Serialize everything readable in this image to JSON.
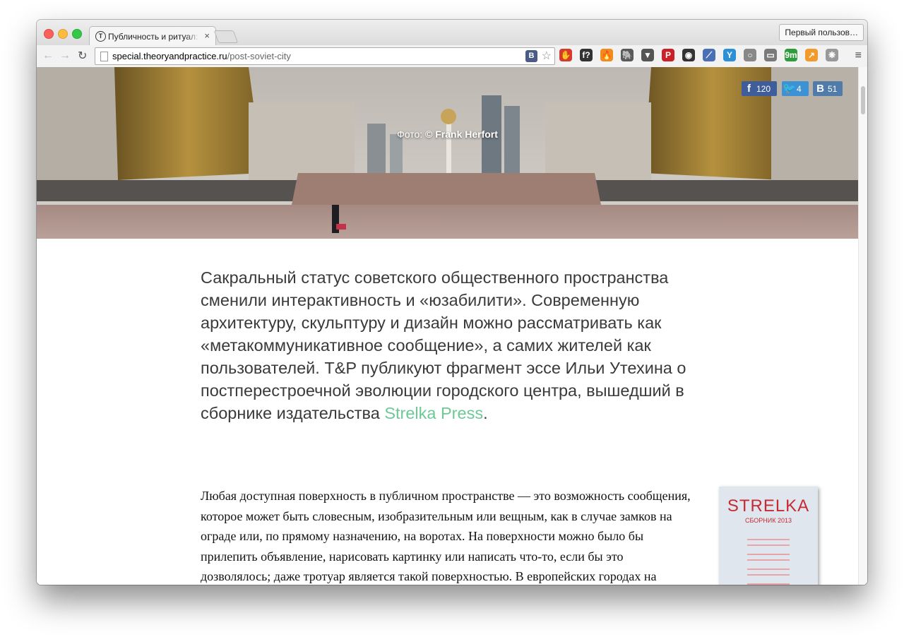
{
  "browser": {
    "tab_title": "Публичность и ритуал: Ил",
    "tab_close": "×",
    "profile_label": "Первый пользов…",
    "url_host": "special.theoryandpractice.ru",
    "url_path": "/post-soviet-city",
    "back_icon": "←",
    "forward_icon": "→",
    "reload_icon": "↻",
    "menu_icon": "≡",
    "vk_ext_label": "B",
    "star_icon": "☆",
    "extensions": [
      {
        "icon": "adblock-icon",
        "glyph": "✋",
        "color": "#d53a2d"
      },
      {
        "icon": "fontface-icon",
        "glyph": "f?",
        "color": "#333333"
      },
      {
        "icon": "fire-icon",
        "glyph": "🔥",
        "color": "#f18a1f"
      },
      {
        "icon": "evernote-icon",
        "glyph": "🐘",
        "color": "#5a5a5a"
      },
      {
        "icon": "pocket-icon",
        "glyph": "▼",
        "color": "#555555"
      },
      {
        "icon": "pinterest-icon",
        "glyph": "P",
        "color": "#cb2027"
      },
      {
        "icon": "camera-icon",
        "glyph": "◉",
        "color": "#333333"
      },
      {
        "icon": "eyedropper-icon",
        "glyph": "⟋",
        "color": "#4a6fb5"
      },
      {
        "icon": "y-icon",
        "glyph": "Y",
        "color": "#2d8fd5"
      },
      {
        "icon": "circle-icon",
        "glyph": "○",
        "color": "#888888"
      },
      {
        "icon": "book-icon",
        "glyph": "▭",
        "color": "#7a7a7a"
      },
      {
        "icon": "weather-icon",
        "glyph": "9m",
        "color": "#2e9b3c"
      },
      {
        "icon": "chart-icon",
        "glyph": "↗",
        "color": "#f29a2b"
      },
      {
        "icon": "paw-icon",
        "glyph": "❋",
        "color": "#999999"
      }
    ]
  },
  "hero": {
    "credit_prefix": "Фото: ",
    "credit_name": "© Frank Herfort"
  },
  "share": {
    "fb_count": "120",
    "tw_count": "4",
    "vk_count": "51",
    "fb_glyph": "f",
    "tw_glyph": "🐦",
    "vk_glyph": "B"
  },
  "article": {
    "lead_text": "Сакральный статус советского общественного пространства сменили интерактивность и «юзабилити». Современную архитектуру, скульптуру и дизайн можно рассматривать как «метакоммуникативное сообщение», а самих жителей как пользователей. T&P публикуют фрагмент эссе Ильи Утехина о постперестроечной эволюции городского центра, вышедший в сборнике издательства ",
    "lead_link": "Strelka Press",
    "lead_end": ".",
    "body_text": "Любая доступная поверхность в публичном пространстве — это возможность сообщения, которое может быть словесным, изобразительным или вещным, как в случае замков на ограде или, по прямому назначению, на воротах. На поверхности можно было бы прилепить объявление, нарисовать картинку или написать что-то, если бы это дозволялось; даже тротуар является такой поверхностью. В европейских городах на многих стенах есть лишь одна, но"
  },
  "book": {
    "title": "STRELKA",
    "subtitle": "СБОРНИК 2013"
  },
  "colors": {
    "link": "#6cc994",
    "facebook": "#3f5d9a",
    "twitter": "#3d92d5",
    "vk": "#517ba8",
    "book_red": "#c62a33"
  }
}
